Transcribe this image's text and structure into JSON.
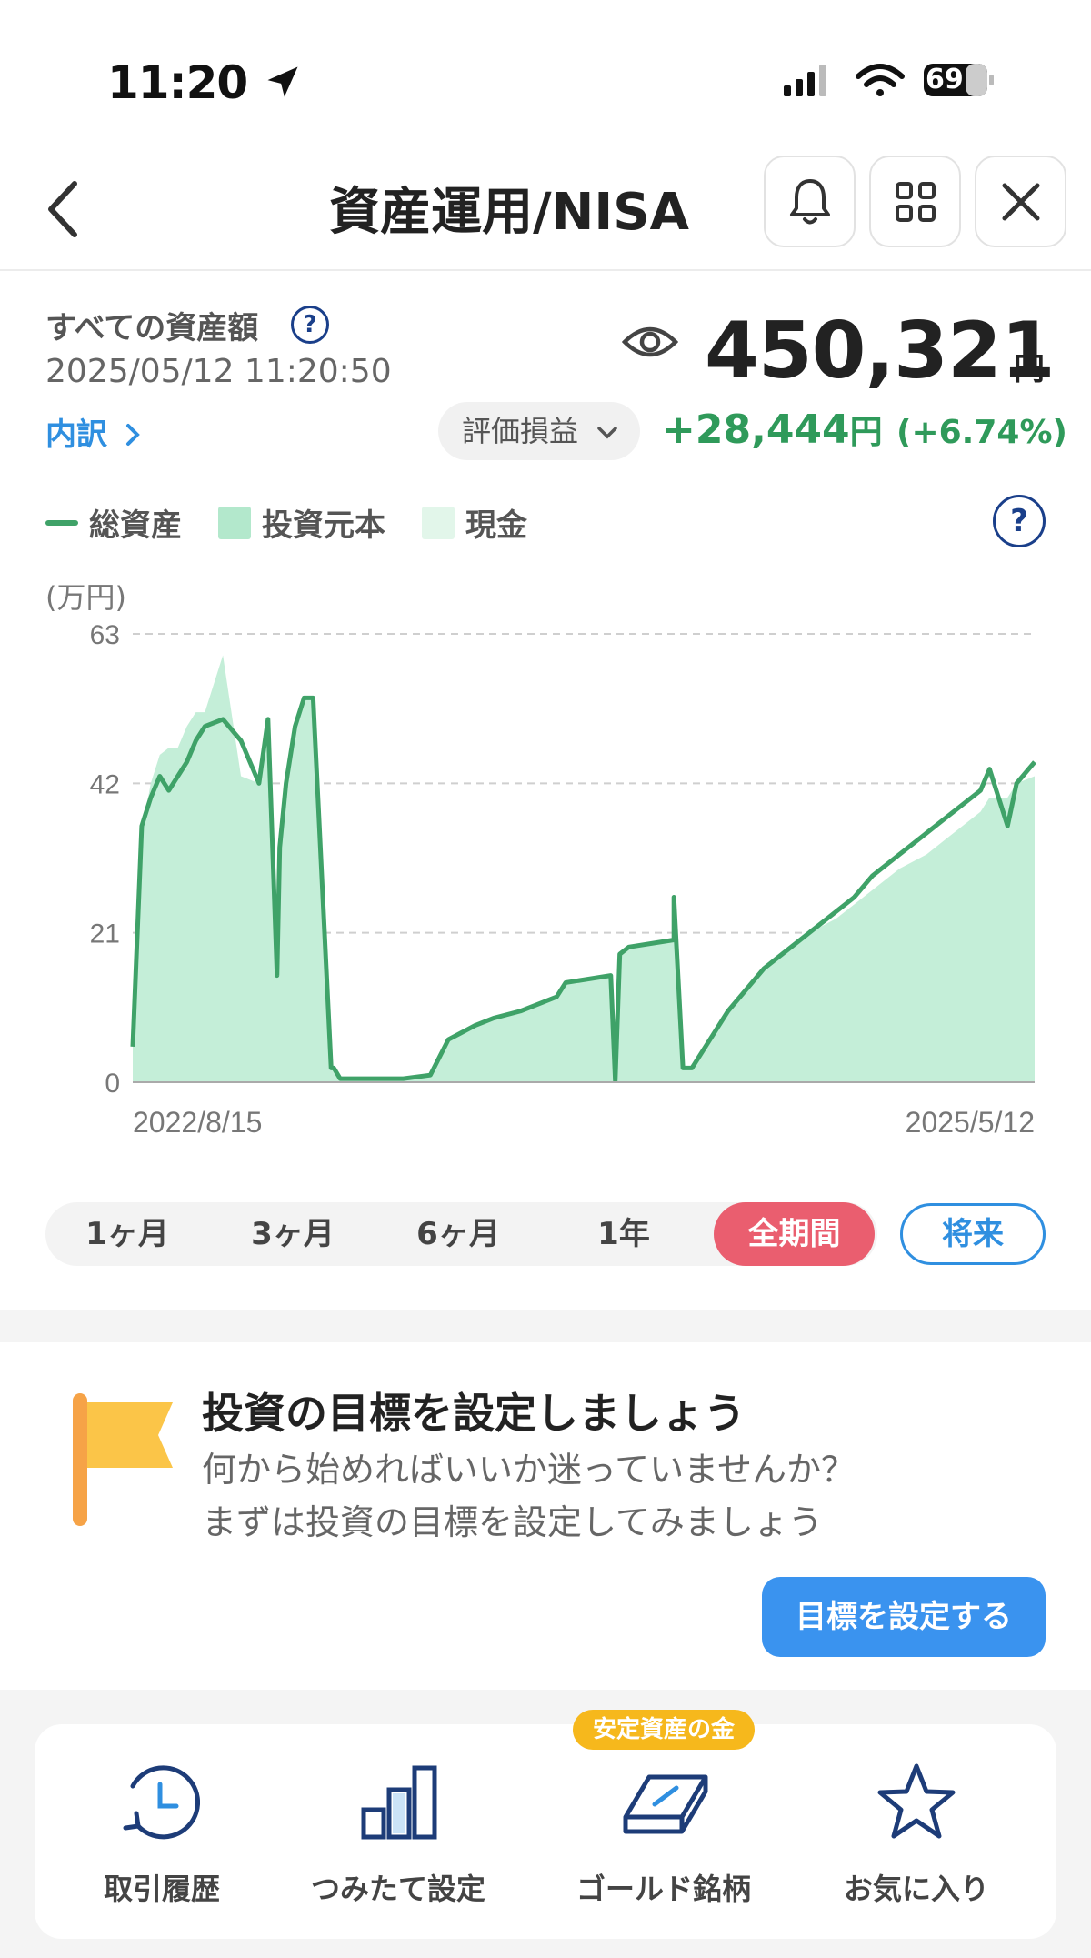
{
  "status_bar": {
    "time": "11:20",
    "battery": "69"
  },
  "header": {
    "title": "資産運用/NISA"
  },
  "summary": {
    "label": "すべての資産額",
    "datetime": "2025/05/12 11:20:50",
    "breakdown_link": "内訳",
    "total": "450,321",
    "currency": "円",
    "pnl_selector": "評価損益",
    "gain": "+28,444",
    "gain_currency": "円",
    "gain_pct": "(+6.74%)"
  },
  "legend": [
    {
      "label": "総資産",
      "color": "#3fa268"
    },
    {
      "label": "投資元本",
      "color": "#b3e8cc"
    },
    {
      "label": "現金",
      "color": "#e2f6ea"
    }
  ],
  "chart_data": {
    "type": "area",
    "unit_label": "(万円)",
    "x_start_label": "2022/8/15",
    "x_end_label": "2025/5/12",
    "y_ticks": [
      "63",
      "42",
      "21",
      "0"
    ],
    "ylim": [
      0,
      63
    ],
    "x": [
      0,
      0.01,
      0.02,
      0.03,
      0.04,
      0.05,
      0.06,
      0.07,
      0.08,
      0.1,
      0.12,
      0.14,
      0.15,
      0.16,
      0.163,
      0.17,
      0.18,
      0.19,
      0.2,
      0.22,
      0.223,
      0.23,
      0.27,
      0.3,
      0.33,
      0.35,
      0.38,
      0.4,
      0.43,
      0.45,
      0.47,
      0.48,
      0.53,
      0.535,
      0.54,
      0.55,
      0.6,
      0.6,
      0.61,
      0.62,
      0.64,
      0.66,
      0.68,
      0.7,
      0.72,
      0.75,
      0.78,
      0.8,
      0.82,
      0.85,
      0.88,
      0.9,
      0.92,
      0.94,
      0.95,
      0.96,
      0.97,
      0.98,
      1.0
    ],
    "series": [
      {
        "name": "総資産",
        "values": [
          5,
          36,
          40,
          43,
          41,
          43,
          45,
          48,
          50,
          51,
          48,
          42,
          51,
          15,
          33,
          42,
          50,
          54,
          54,
          2,
          2,
          0.5,
          0.5,
          0.5,
          1,
          6,
          8,
          9,
          10,
          11,
          12,
          14,
          15,
          0.2,
          18,
          19,
          20,
          26,
          2,
          2,
          6,
          10,
          13,
          16,
          18,
          21,
          24,
          26,
          29,
          32,
          35,
          37,
          39,
          41,
          44,
          40,
          36,
          42,
          45
        ]
      },
      {
        "name": "投資元本",
        "values": [
          5,
          35,
          42,
          46,
          47,
          47,
          50,
          52,
          52,
          60,
          43,
          42,
          51,
          15,
          33,
          42,
          50,
          54,
          54,
          2,
          2,
          0.5,
          0.5,
          0.5,
          1,
          6,
          8,
          9,
          10,
          11,
          12,
          14,
          15,
          0.2,
          18,
          19,
          20,
          26,
          2,
          2,
          6,
          10,
          13,
          16,
          18,
          21,
          23,
          25,
          27,
          30,
          32,
          34,
          36,
          38,
          40,
          40,
          40,
          42,
          43
        ]
      }
    ]
  },
  "range_tabs": [
    "1ヶ月",
    "3ヶ月",
    "6ヶ月",
    "1年",
    "全期間"
  ],
  "active_tab": "全期間",
  "future_button": "将来",
  "goal": {
    "title": "投資の目標を設定しましょう",
    "line1": "何から始めればいいか迷っていませんか？",
    "line2": "まずは投資の目標を設定してみましょう",
    "button": "目標を設定する"
  },
  "shortcuts": [
    {
      "label": "取引履歴",
      "icon": "history-icon"
    },
    {
      "label": "つみたて設定",
      "icon": "bar-chart-icon"
    },
    {
      "label": "ゴールド銘柄",
      "icon": "gold-bar-icon",
      "badge": "安定資産の金"
    },
    {
      "label": "お気に入り",
      "icon": "star-icon"
    }
  ]
}
